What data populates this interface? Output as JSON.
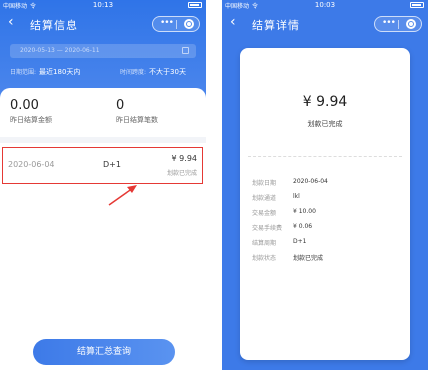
{
  "left": {
    "status": {
      "carrier": "中国移动",
      "wifi": "令",
      "time": "10:13"
    },
    "nav": {
      "back": "‹",
      "title": "结算信息",
      "more": "•••"
    },
    "date_range": "2020-05-13 — 2020-06-11",
    "filters": {
      "range_label": "日期范围:",
      "range_value": "最近180天内",
      "span_label": "时间跨度:",
      "span_value": "不大于30天"
    },
    "stats": [
      {
        "value": "0.00",
        "label": "昨日结算金额"
      },
      {
        "value": "0",
        "label": "昨日结算笔数"
      }
    ],
    "row": {
      "date": "2020-06-04",
      "period": "D+1",
      "amount": "¥ 9.94",
      "status": "划款已完成"
    },
    "query_button": "结算汇总查询"
  },
  "right": {
    "status": {
      "carrier": "中国移动",
      "wifi": "令",
      "time": "10:03"
    },
    "nav": {
      "back": "‹",
      "title": "结算详情",
      "more": "•••"
    },
    "amount": "¥ 9.94",
    "amount_status": "划款已完成",
    "details": [
      {
        "key": "划款日期",
        "value": "2020-06-04"
      },
      {
        "key": "划款通道",
        "value": "lkl"
      },
      {
        "key": "交易金额",
        "value": "¥ 10.00"
      },
      {
        "key": "交易手续费",
        "value": "¥ 0.06"
      },
      {
        "key": "结算周期",
        "value": "D+1"
      },
      {
        "key": "划款状态",
        "value": "划款已完成"
      }
    ]
  },
  "colors": {
    "primary": "#3d7ae8",
    "highlight": "#e53935"
  }
}
